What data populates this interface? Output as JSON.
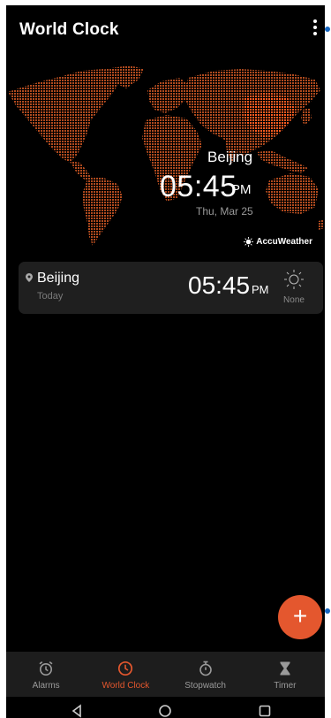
{
  "app": {
    "title": "World Clock"
  },
  "map": {
    "city": "Beijing",
    "time": "05:45",
    "ampm": "PM",
    "date": "Thu, Mar 25",
    "provider": "AccuWeather",
    "land_color": "#b04a1e",
    "highlight_color": "#ff5a20"
  },
  "clocks": [
    {
      "city": "Beijing",
      "day": "Today",
      "time": "05:45",
      "ampm": "PM",
      "weather": "None",
      "weather_icon": "sun-icon"
    }
  ],
  "fab": {
    "label": "+"
  },
  "tabs": [
    {
      "label": "Alarms",
      "icon": "alarm-clock-icon",
      "active": false
    },
    {
      "label": "World Clock",
      "icon": "clock-icon",
      "active": true
    },
    {
      "label": "Stopwatch",
      "icon": "stopwatch-icon",
      "active": false
    },
    {
      "label": "Timer",
      "icon": "hourglass-icon",
      "active": false
    }
  ],
  "colors": {
    "accent": "#e4572e",
    "card": "#1f1f1f",
    "tabbar": "#1d1d1d",
    "background": "#000000",
    "edge_dot": "#1565c0"
  }
}
